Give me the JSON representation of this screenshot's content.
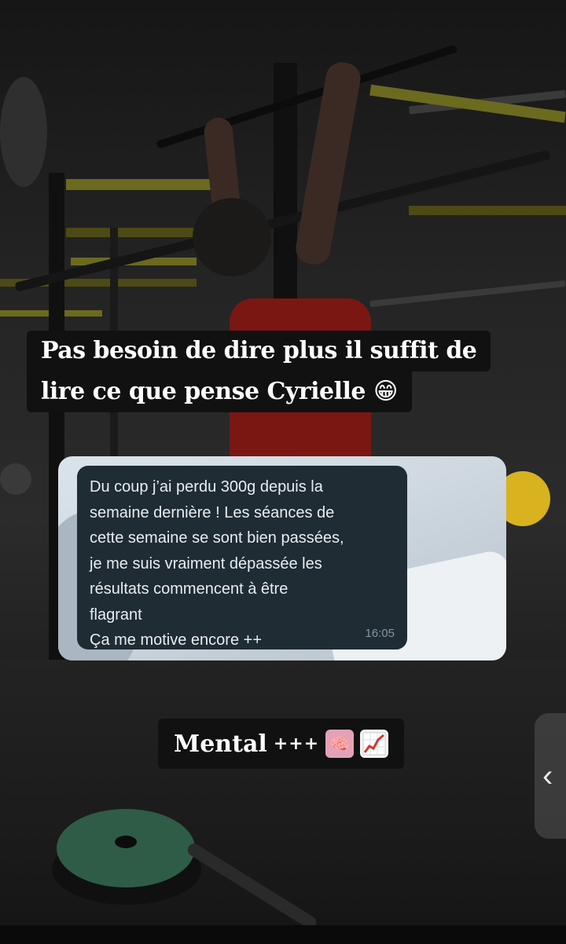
{
  "story": {
    "headline_line1": "Pas besoin de dire plus il suffit de",
    "headline_line2": "lire ce que pense Cyrielle",
    "headline_emoji": "😁",
    "tag_word": "Mental",
    "tag_plus": "+++",
    "tag_emoji_1": "🧠",
    "tag_emoji_2": "📈"
  },
  "chat": {
    "message": "Du coup j’ai perdu 300g depuis la\nsemaine dernière ! Les séances de\ncette semaine se sont bien passées,\nje me suis vraiment dépassée les\nrésultats commencent à être\nflagrant\nÇa me motive encore ++",
    "time": "16:05"
  },
  "side_handle": {
    "glyph": "‹",
    "icon": "chevron-left-icon"
  },
  "colors": {
    "text_pill_bg": "#111111",
    "bubble_bg": "#1f2c34",
    "bubble_text": "#e9edef",
    "bubble_time": "#8696a0"
  }
}
